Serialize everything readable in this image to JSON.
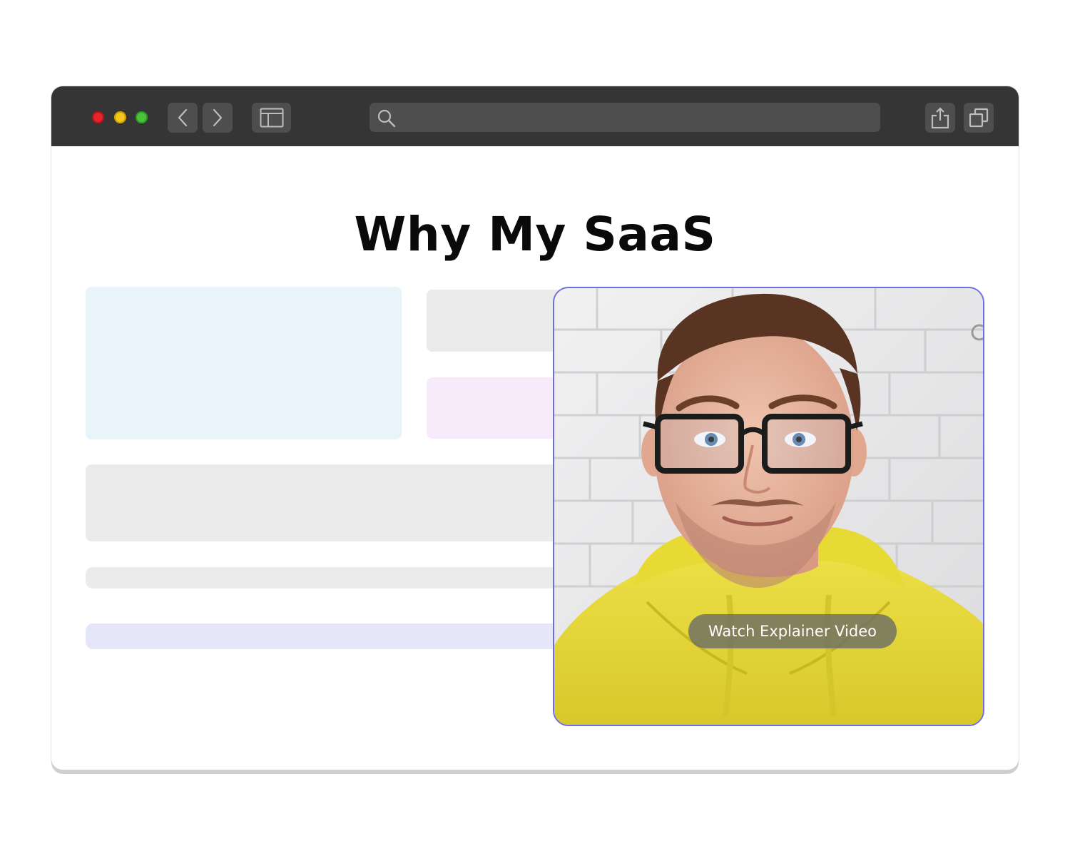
{
  "browser": {
    "controls": {
      "close": "traffic-light-red",
      "minimize": "traffic-light-yellow",
      "maximize": "traffic-light-green"
    },
    "toolbar": {
      "back_icon": "chevron-left-icon",
      "forward_icon": "chevron-right-icon",
      "sidebar_icon": "sidebar-icon",
      "share_icon": "share-icon",
      "tabs_icon": "tabs-icon"
    },
    "address_bar": {
      "value": "",
      "placeholder": "",
      "icon": "search-icon"
    }
  },
  "page": {
    "title": "Why My SaaS",
    "video": {
      "caption": "Watch Explainer Video",
      "border_color": "#6e6ee0"
    }
  },
  "colors": {
    "titlebar": "#353535",
    "placeholder_gray": "#ebebeb",
    "placeholder_blue": "#e8f4fa",
    "placeholder_pink": "#f6eafb",
    "placeholder_lavender": "#e5e7f8",
    "hoodie_yellow": "#e6dc3a"
  }
}
